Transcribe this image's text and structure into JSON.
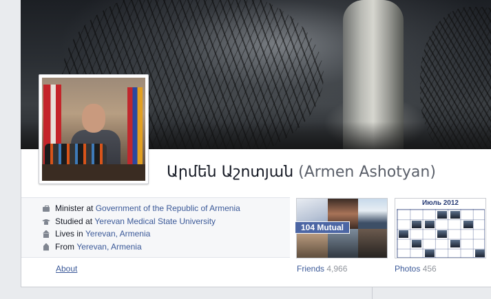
{
  "profile": {
    "name": "Արմեն Աշոտյան",
    "alternate_name": "(Armen Ashotyan)"
  },
  "intro": {
    "work": {
      "prefix": "Minister at ",
      "link": "Government of the Republic of Armenia",
      "icon": "briefcase-icon"
    },
    "education": {
      "prefix": "Studied at ",
      "link": "Yerevan Medical State University",
      "icon": "graduation-cap-icon"
    },
    "lives": {
      "prefix": "Lives in ",
      "link": "Yerevan, Armenia",
      "icon": "home-icon"
    },
    "from": {
      "prefix": "From ",
      "link": "Yerevan, Armenia",
      "icon": "location-pin-icon"
    }
  },
  "nav": {
    "about": "About"
  },
  "friends": {
    "label": "Friends",
    "count": "4,966",
    "mutual_badge": "104 Mutual"
  },
  "photos": {
    "label": "Photos",
    "count": "456",
    "calendar_title": "Июль 2012"
  },
  "colors": {
    "link": "#3b5998",
    "muted": "#90949c",
    "badge": "#4c66a4"
  }
}
